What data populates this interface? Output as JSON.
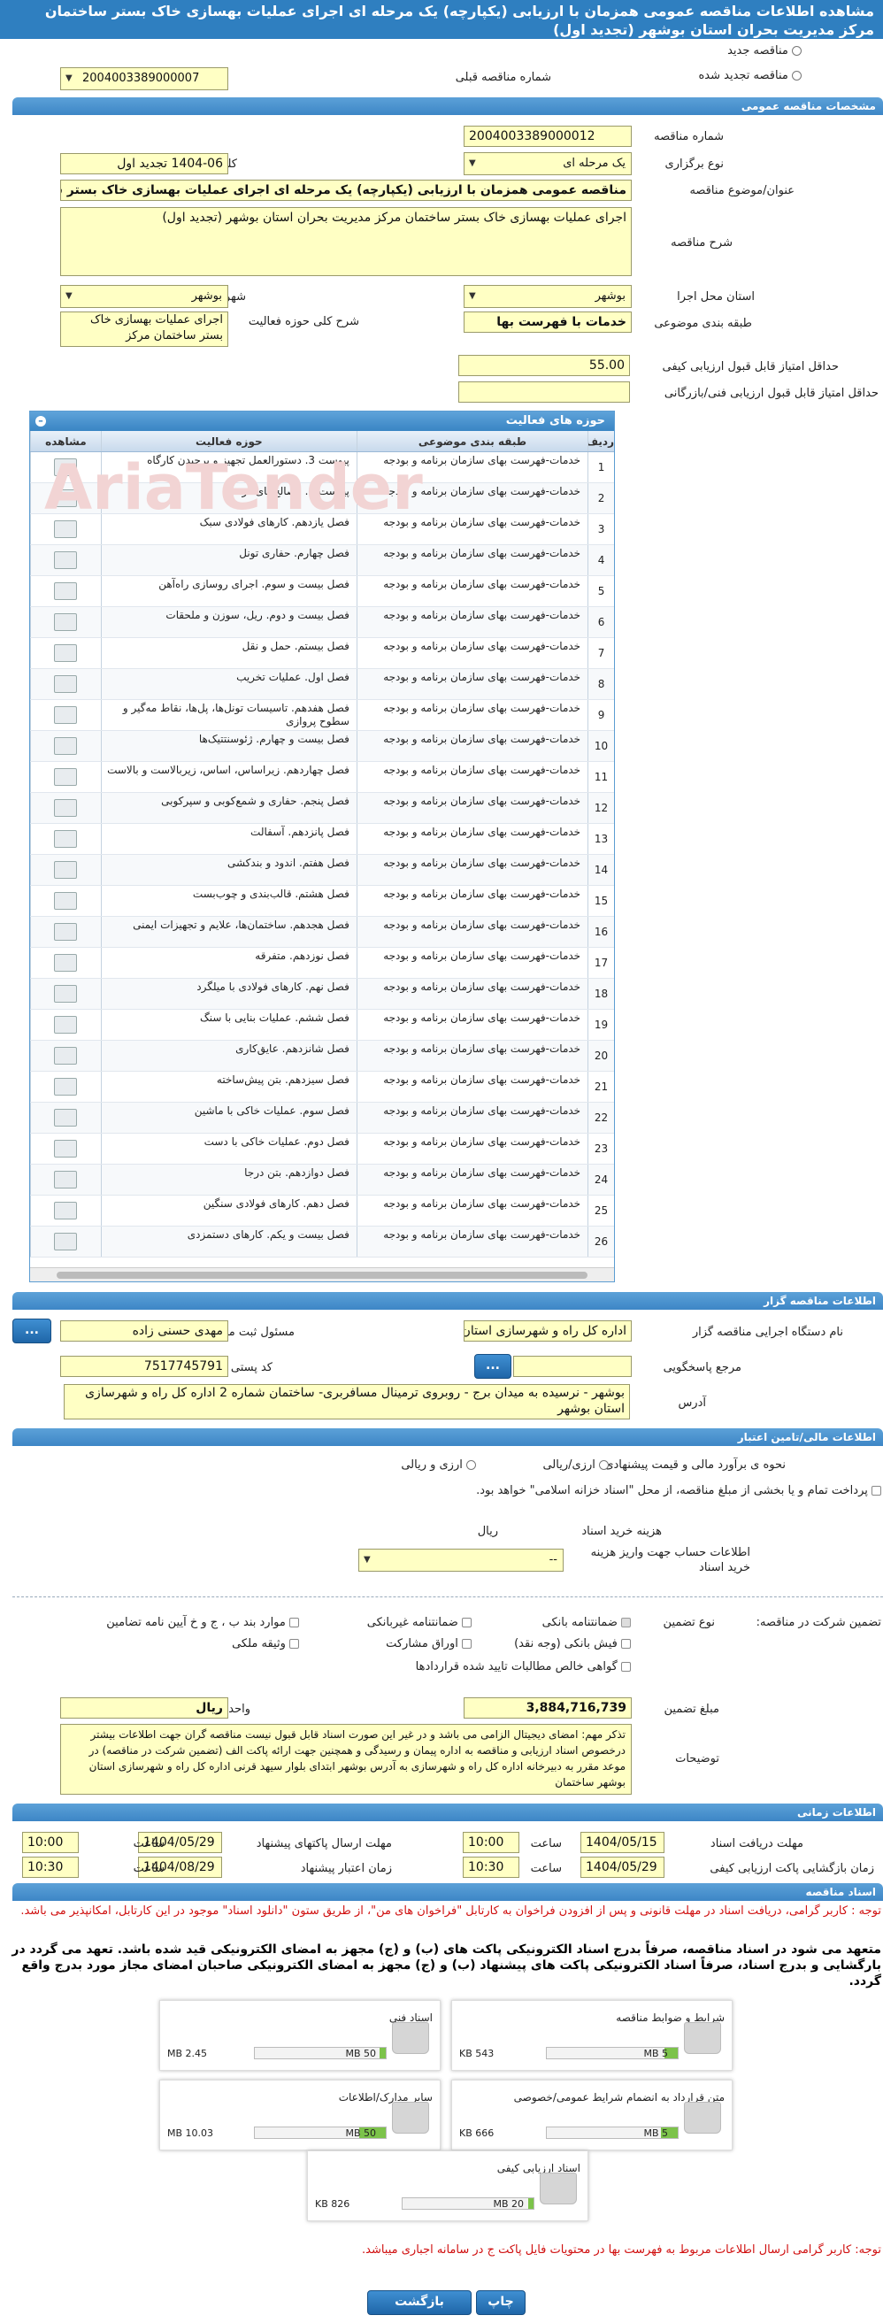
{
  "title": "مشاهده اطلاعات مناقصه عمومی همزمان با ارزیابی (یکپارچه) یک مرحله ای اجرای عملیات بهسازی خاک بستر ساختمان مرکز مدیریت بحران استان بوشهر (تجدید اول)",
  "top": {
    "new": "مناقصه جدید",
    "renewed": "مناقصه تجدید شده",
    "prev_label": "شماره مناقصه قبلی",
    "prev_value": "2004003389000007"
  },
  "sections": {
    "general": "مشخصات مناقصه عمومی",
    "organizer": "اطلاعات مناقصه گزار",
    "financial": "اطلاعات مالی/تامین اعتبار",
    "timing": "اطلاعات زمانی",
    "docs": "اسناد مناقصه"
  },
  "general": {
    "number_label": "شماره مناقصه",
    "number": "2004003389000012",
    "holding_label": "نوع برگزاری",
    "holding": "یک مرحله ای",
    "keyword_label": "کلید واژه",
    "keyword": "1404-06 تجدید اول",
    "subject_label": "عنوان/موضوع مناقصه",
    "subject": "مناقصه عمومی همزمان با ارزیابی (یکپارچه) یک مرحله ای اجرای عملیات بهسازی خاک بستر ساختمان مرکز مدیریت بحران استان بوشهر (تجدید اول)",
    "desc_label": "شرح مناقصه",
    "desc": "اجرای عملیات بهسازی خاک بستر ساختمان مرکز مدیریت بحران استان بوشهر (تجدید اول)",
    "province_label": "استان محل اجرا",
    "province": "بوشهر",
    "city_label": "شهر محل اجرا",
    "city": "بوشهر",
    "category_label": "طبقه بندی موضوعی",
    "category": "خدمات با فهرست بها",
    "scope_label": "شرح کلی حوزه فعالیت",
    "scope": "اجرای عملیات بهسازی خاک بستر ساختمان مرکز",
    "quality_label": "حداقل امتیاز قابل قبول ارزیابی کیفی",
    "quality": "55.00",
    "tech_label": "حداقل امتیاز قابل قبول ارزیابی فنی/بازرگانی",
    "tech": ""
  },
  "activities": {
    "title": "حوزه های فعالیت",
    "headers": {
      "row": "ردیف",
      "category": "طبقه بندی موضوعی",
      "scope": "حوزه فعالیت",
      "view": "مشاهده"
    },
    "rows": [
      {
        "n": "1",
        "cat": "خدمات-فهرست بهای سازمان برنامه و بودجه",
        "scope": "پیوست 3. دستورالعمل تجهیز و برچیدن کارگاه"
      },
      {
        "n": "2",
        "cat": "خدمات-فهرست بهای سازمان برنامه و بودجه",
        "scope": "پیوست 1. مصالح پای‌کار"
      },
      {
        "n": "3",
        "cat": "خدمات-فهرست بهای سازمان برنامه و بودجه",
        "scope": "فصل یازدهم. کارهای فولادی سبک"
      },
      {
        "n": "4",
        "cat": "خدمات-فهرست بهای سازمان برنامه و بودجه",
        "scope": "فصل چهارم. حفاری تونل"
      },
      {
        "n": "5",
        "cat": "خدمات-فهرست بهای سازمان برنامه و بودجه",
        "scope": "فصل بیست و سوم. اجرای روسازی راه‌آهن"
      },
      {
        "n": "6",
        "cat": "خدمات-فهرست بهای سازمان برنامه و بودجه",
        "scope": "فصل بیست و دوم. ریل، سوزن و ملحقات"
      },
      {
        "n": "7",
        "cat": "خدمات-فهرست بهای سازمان برنامه و بودجه",
        "scope": "فصل بیستم. حمل و نقل"
      },
      {
        "n": "8",
        "cat": "خدمات-فهرست بهای سازمان برنامه و بودجه",
        "scope": "فصل اول. عملیات تخریب"
      },
      {
        "n": "9",
        "cat": "خدمات-فهرست بهای سازمان برنامه و بودجه",
        "scope": "فصل هفدهم. تاسیسات تونل‌ها، پل‌ها، نقاط مه‌گیر و سطوح پروازی"
      },
      {
        "n": "10",
        "cat": "خدمات-فهرست بهای سازمان برنامه و بودجه",
        "scope": "فصل بیست و چهارم. ژئوسنتتیک‌ها"
      },
      {
        "n": "11",
        "cat": "خدمات-فهرست بهای سازمان برنامه و بودجه",
        "scope": "فصل چهاردهم. زیراساس، اساس، زیربالاست و بالاست"
      },
      {
        "n": "12",
        "cat": "خدمات-فهرست بهای سازمان برنامه و بودجه",
        "scope": "فصل پنجم. حفاری و شمع‌کوبی و سپرکوبی"
      },
      {
        "n": "13",
        "cat": "خدمات-فهرست بهای سازمان برنامه و بودجه",
        "scope": "فصل پانزدهم. آسفالت"
      },
      {
        "n": "14",
        "cat": "خدمات-فهرست بهای سازمان برنامه و بودجه",
        "scope": "فصل هفتم. اندود و بندکشی"
      },
      {
        "n": "15",
        "cat": "خدمات-فهرست بهای سازمان برنامه و بودجه",
        "scope": "فصل هشتم. قالب‌بندی و چوب‌بست"
      },
      {
        "n": "16",
        "cat": "خدمات-فهرست بهای سازمان برنامه و بودجه",
        "scope": "فصل هجدهم. ساختمان‌ها، علایم و تجهیزات ایمنی"
      },
      {
        "n": "17",
        "cat": "خدمات-فهرست بهای سازمان برنامه و بودجه",
        "scope": "فصل نوزدهم. متفرقه"
      },
      {
        "n": "18",
        "cat": "خدمات-فهرست بهای سازمان برنامه و بودجه",
        "scope": "فصل نهم. کارهای فولادی با میلگرد"
      },
      {
        "n": "19",
        "cat": "خدمات-فهرست بهای سازمان برنامه و بودجه",
        "scope": "فصل ششم. عملیات بنایی با سنگ"
      },
      {
        "n": "20",
        "cat": "خدمات-فهرست بهای سازمان برنامه و بودجه",
        "scope": "فصل شانزدهم. عایق‌کاری"
      },
      {
        "n": "21",
        "cat": "خدمات-فهرست بهای سازمان برنامه و بودجه",
        "scope": "فصل سیزدهم. بتن پیش‌ساخته"
      },
      {
        "n": "22",
        "cat": "خدمات-فهرست بهای سازمان برنامه و بودجه",
        "scope": "فصل سوم. عملیات خاکی با ماشین"
      },
      {
        "n": "23",
        "cat": "خدمات-فهرست بهای سازمان برنامه و بودجه",
        "scope": "فصل دوم. عملیات خاکی با دست"
      },
      {
        "n": "24",
        "cat": "خدمات-فهرست بهای سازمان برنامه و بودجه",
        "scope": "فصل دوازدهم. بتن درجا"
      },
      {
        "n": "25",
        "cat": "خدمات-فهرست بهای سازمان برنامه و بودجه",
        "scope": "فصل دهم. کارهای فولادی سنگین"
      },
      {
        "n": "26",
        "cat": "خدمات-فهرست بهای سازمان برنامه و بودجه",
        "scope": "فصل بیست و یکم. کارهای دستمزدی"
      }
    ]
  },
  "organizer": {
    "org_label": "نام دستگاه اجرایی مناقصه گزار",
    "org": "اداره کل راه و شهرسازی استان بوشهر",
    "resp_label": "مسئول ثبت مناقصه",
    "resp": "مهدی حسنی زاده",
    "ref_label": "مرجع پاسخگویی",
    "ref": "",
    "postal_label": "کد پستی",
    "postal": "7517745791",
    "address_label": "آدرس",
    "address": "بوشهر - نرسیده به میدان برج - روبروی ترمینال مسافربری- ساختمان شماره 2 اداره کل راه و شهرسازی استان بوشهر",
    "btn": "..."
  },
  "financial": {
    "estimate_label": "نحوه ی برآورد مالی و قیمت پیشنهادی",
    "opt1": "ارزی/ریالی",
    "opt2": "ارزی و ریالی",
    "payment_text": "پرداخت تمام و یا بخشی از مبلغ مناقصه، از محل \"اسناد خزانه اسلامی\" خواهد بود.",
    "doc_fee_label": "هزینه خرید اسناد",
    "doc_fee_unit": "ریال",
    "account_label": "اطلاعات حساب جهت واریز هزینه خرید اسناد",
    "account": "--",
    "guarantee_label": "تضمین شرکت در مناقصه:",
    "guarantee_type_label": "نوع تضمین",
    "g1": "ضمانتنامه بانکی",
    "g2": "ضمانتنامه غیربانکی",
    "g3": "موارد بند ب ، ج و خ آیین نامه تضامین",
    "g4": "فیش بانکی (وجه نقد)",
    "g5": "اوراق مشارکت",
    "g6": "وثیقه ملکی",
    "g7": "گواهی خالص مطالبات تایید شده قراردادها",
    "amount_label": "مبلغ تضمین",
    "amount": "3,884,716,739",
    "unit_label": "واحد پول",
    "unit": "ریال",
    "notes_label": "توضیحات",
    "notes": "تذکر مهم: امضای دیجیتال الزامی می باشد و در غیر این صورت اسناد قابل قبول نیست مناقصه گران جهت اطلاعات بیشتر درخصوص اسناد ارزیابی و مناقصه به اداره پیمان و رسیدگی و همچنین جهت ارائه پاکت الف (تضمین شرکت در مناقصه) در موعد مقرر به دبیرخانه اداره کل راه و شهرسازی به آدرس بوشهر ابتدای بلوار سیهد قرنی اداره کل راه و شهرسازی استان بوشهر ساختمان"
  },
  "timing": {
    "t1_label": "مهلت دریافت اسناد",
    "t1_date": "1404/05/15",
    "t1_time": "10:00",
    "t2_label": "مهلت ارسال پاکتهای پیشنهاد",
    "t2_date": "1404/05/29",
    "t2_time": "10:00",
    "t3_label": "زمان بازگشایی پاکت ارزیابی کیفی",
    "t3_date": "1404/05/29",
    "t3_time": "10:30",
    "t4_label": "زمان اعتبار پیشنهاد",
    "t4_date": "1404/08/29",
    "t4_time": "10:30",
    "time_label": "ساعت"
  },
  "docs": {
    "note1": "توجه : کاربر گرامی، دریافت اسناد در مهلت قانونی و پس از افزودن فراخوان به کارتابل \"فراخوان های من\"، از طریق ستون \"دانلود اسناد\" موجود در این کارتابل، امکانپذیر می باشد.",
    "commit": "متعهد می شود در اسناد مناقصه، صرفاً بدرج اسناد الکترونیکی پاکت های (ب) و (ج) مجهز به امضای الکترونیکی قید شده باشد. تعهد می گردد در بارگشایی و بدرج اسناد، صرفاً اسناد الکترونیکی پاکت های پیشنهاد (ب) و (ج) مجهز به امضای الکترونیکی صاحبان امضای مجاز مورد بدرج واقع گردد.",
    "items": [
      {
        "name": "شرایط و ضوابط مناقصه",
        "max": "5 MB",
        "used": "543 KB",
        "fill": "0.1"
      },
      {
        "name": "اسناد فنی",
        "max": "50 MB",
        "used": "2.45 MB",
        "fill": "0.05"
      },
      {
        "name": "متن قرارداد به انضمام شرایط عمومی/خصوصی",
        "max": "5 MB",
        "used": "666 KB",
        "fill": "0.13"
      },
      {
        "name": "سایر مدارک/اطلاعات",
        "max": "50 MB",
        "used": "10.03 MB",
        "fill": "0.2"
      },
      {
        "name": "اسناد ارزیابی کیفی",
        "max": "20 MB",
        "used": "826 KB",
        "fill": "0.04"
      }
    ],
    "note2": "توجه: کاربر گرامی ارسال اطلاعات مربوط به فهرست بها در محتویات فایل پاکت ج در سامانه اجباری میباشد."
  },
  "buttons": {
    "print": "چاپ",
    "back": "بازگشت"
  },
  "watermark": "AriaTender"
}
